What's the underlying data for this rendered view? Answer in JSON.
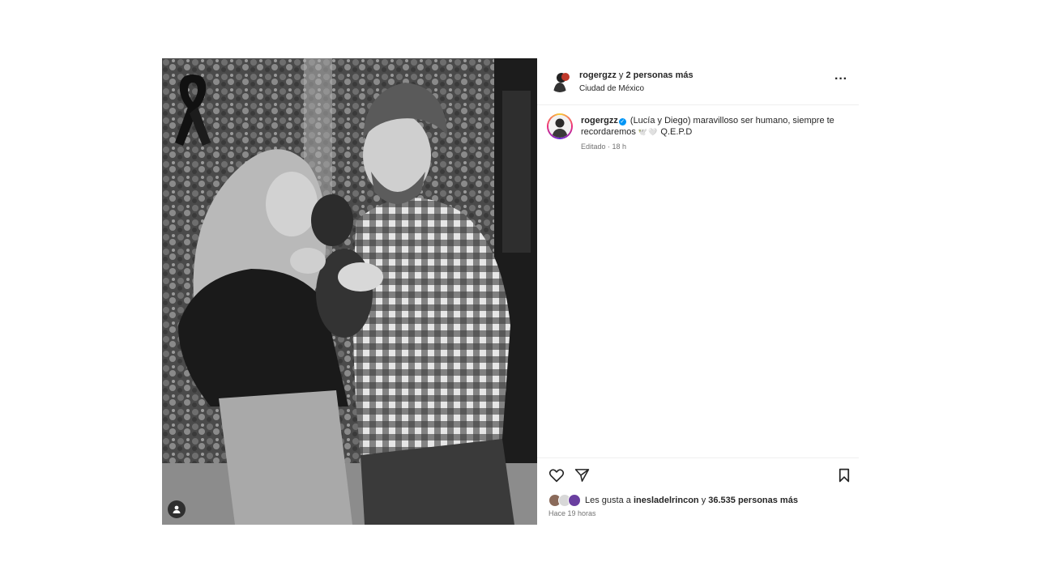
{
  "header": {
    "username": "rogergzz",
    "connector": "y",
    "others": "2 personas más",
    "location": "Ciudad de México",
    "menu_icon": "more-horizontal-icon"
  },
  "caption": {
    "username": "rogergzz",
    "verified": true,
    "text_before": "(Lucía y Diego) maravilloso ser humano, siempre te recordaremos",
    "emoji": "🕊️🤍",
    "text_after": "Q.E.P.D",
    "meta": "Editado · 18 h"
  },
  "media": {
    "ribbon_icon": "black-mourning-ribbon",
    "tag_icon": "user-tag-icon"
  },
  "actions": {
    "like_icon": "heart-icon",
    "share_icon": "paper-plane-icon",
    "save_icon": "bookmark-icon"
  },
  "likes": {
    "prefix": "Les gusta a",
    "liker": "inesladelrincon",
    "connector": "y",
    "others": "36.535 personas más"
  },
  "timestamp": "Hace 19 horas"
}
